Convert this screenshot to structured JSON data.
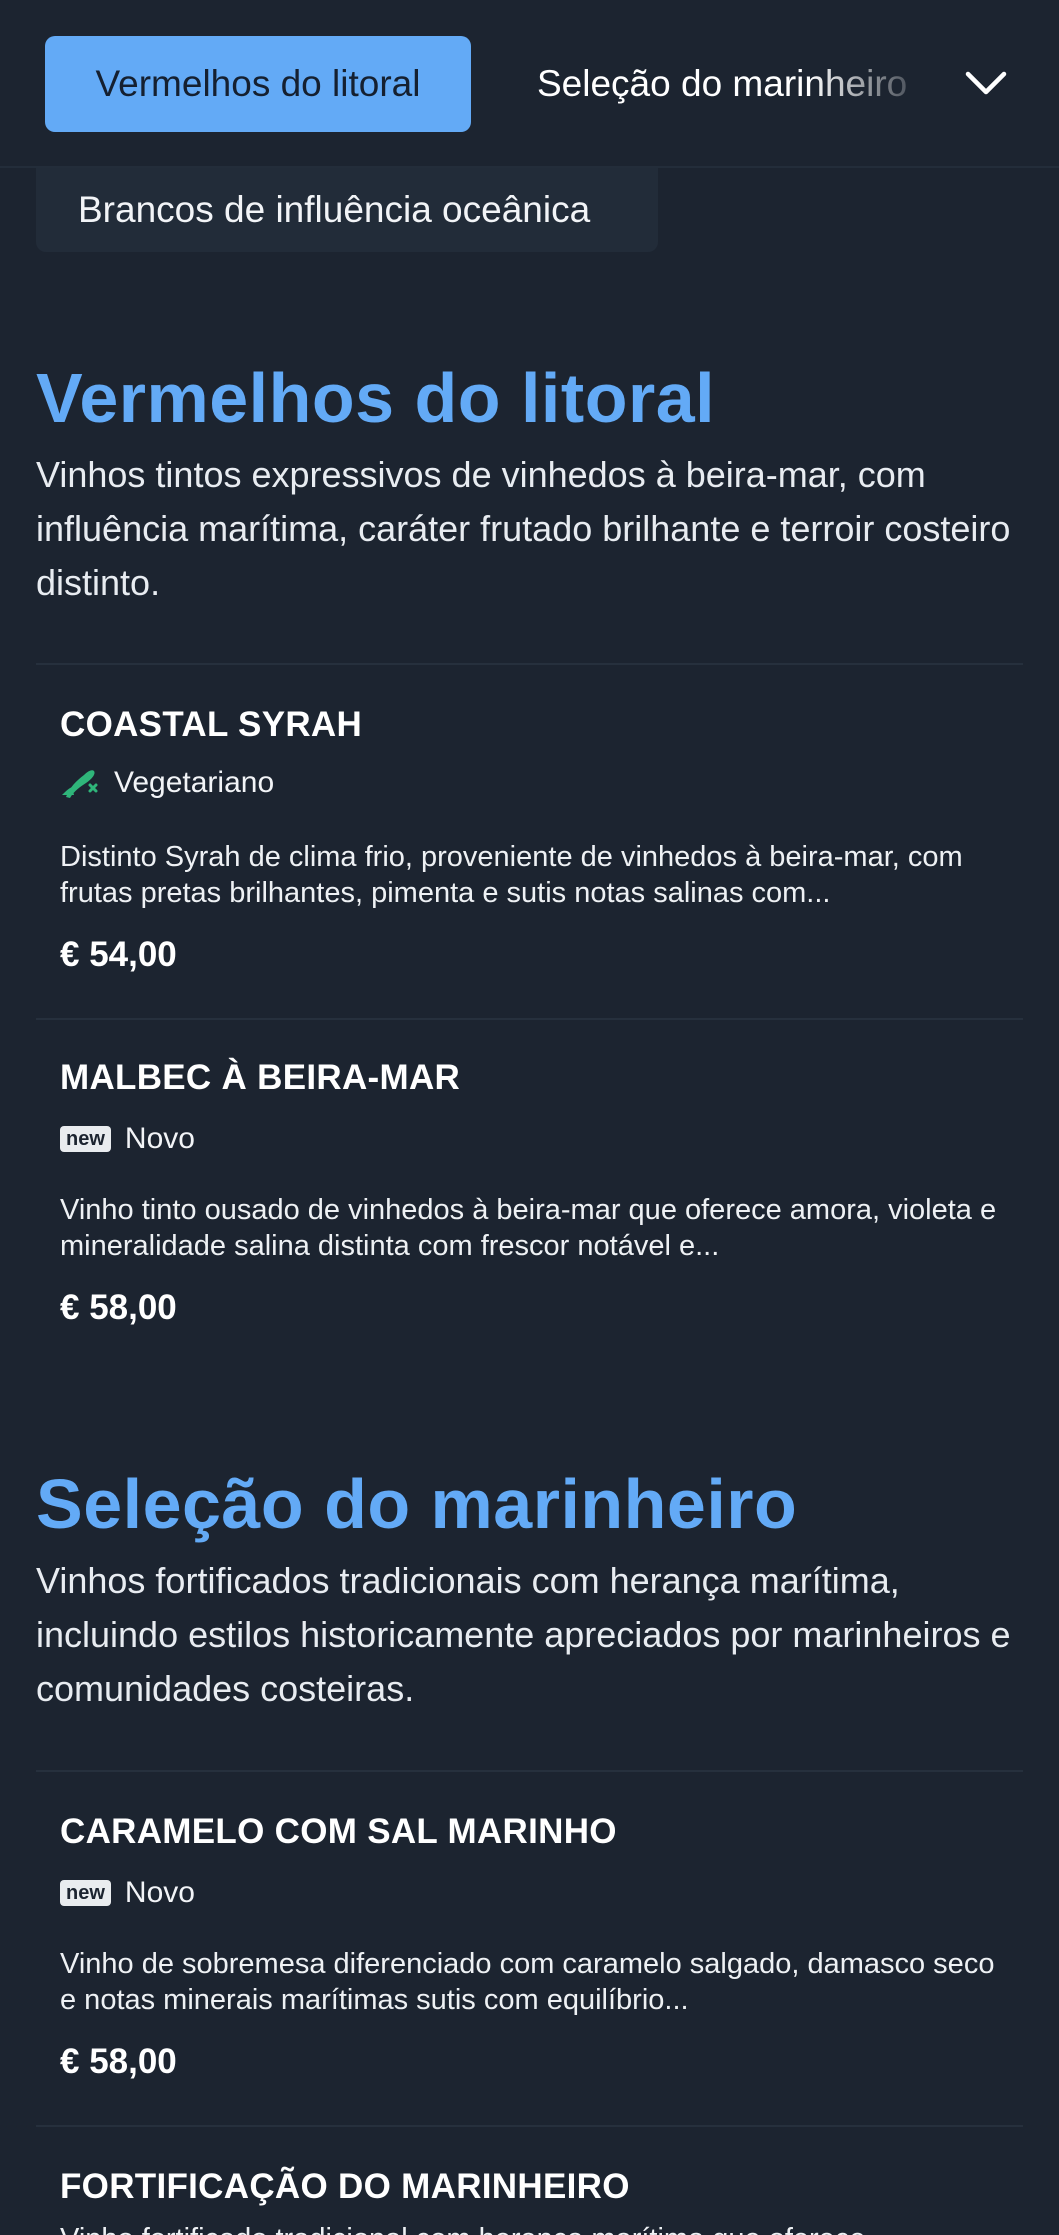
{
  "nav": {
    "active_tab": "Vermelhos do litoral",
    "next_tab": "Seleção do marinheiro",
    "dropdown_item": "Brancos de influência oceânica"
  },
  "sections": [
    {
      "title": "Vermelhos do litoral",
      "description": "Vinhos tintos expressivos de vinhedos à beira-mar, com influência marítima, caráter frutado brilhante e terroir costeiro distinto.",
      "items": [
        {
          "name": "COASTAL SYRAH",
          "tag": "Vegetariano",
          "tag_icon": "vegetarian-icon",
          "description": "Distinto Syrah de clima frio, proveniente de vinhedos à beira-mar, com frutas pretas brilhantes, pimenta e sutis notas salinas com...",
          "price": "€ 54,00"
        },
        {
          "name": "MALBEC À BEIRA-MAR",
          "tag": "Novo",
          "tag_badge": "new",
          "description": "Vinho tinto ousado de vinhedos à beira-mar que oferece amora, violeta e mineralidade salina distinta com frescor notável e...",
          "price": "€ 58,00"
        }
      ]
    },
    {
      "title": "Seleção do marinheiro",
      "description": "Vinhos fortificados tradicionais com herança marítima, incluindo estilos historicamente apreciados por marinheiros e comunidades costeiras.",
      "items": [
        {
          "name": "CARAMELO COM SAL MARINHO",
          "tag": "Novo",
          "tag_badge": "new",
          "description": "Vinho de sobremesa diferenciado com caramelo salgado, damasco seco e notas minerais marítimas sutis com equilíbrio...",
          "price": "€ 58,00"
        },
        {
          "name": "FORTIFICAÇÃO DO MARINHEIRO",
          "description": "Vinho fortificado tradicional com herança marítima que oferece"
        }
      ]
    }
  ],
  "colors": {
    "background": "#1c2430",
    "accent": "#63aaf6",
    "vegetarian_icon": "#2fb57a"
  }
}
